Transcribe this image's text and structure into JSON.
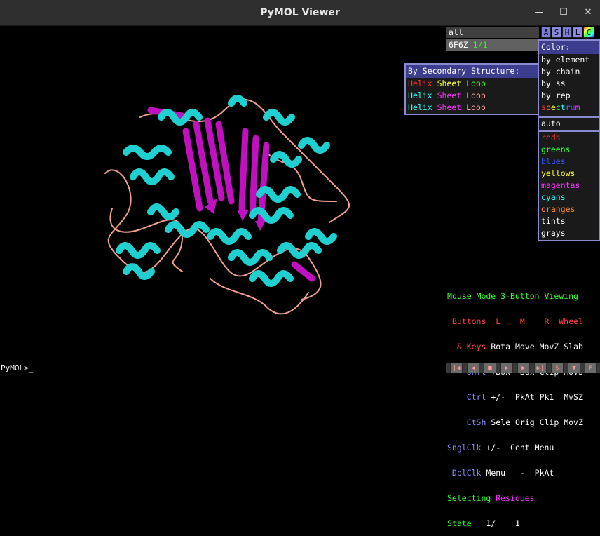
{
  "window": {
    "title": "PyMOL Viewer"
  },
  "command": {
    "prompt": "PyMOL>_"
  },
  "objects": {
    "all": {
      "name": "all"
    },
    "obj1": {
      "name": "6F6Z",
      "frames": "1/1"
    },
    "buttons": [
      {
        "label": "A",
        "color": "#7b7bd8"
      },
      {
        "label": "S",
        "color": "#8a8ae0"
      },
      {
        "label": "H",
        "color": "#7b7bd8"
      },
      {
        "label": "L",
        "color": "#8a8ae0"
      },
      {
        "label": "C",
        "color": "#e8e84a"
      }
    ]
  },
  "ss_menu": {
    "title": "By Secondary Structure:",
    "rows": [
      [
        "Helix",
        "Sheet",
        "Loop"
      ],
      [
        "Helix",
        "Sheet",
        "Loop"
      ],
      [
        "Helix",
        "Sheet",
        "Loop"
      ]
    ],
    "row_colors": [
      [
        "#ff3030",
        "#ffff30",
        "#30ff30"
      ],
      [
        "#30ffff",
        "#ff30ff",
        "#ff9f9f"
      ],
      [
        "#30ffff",
        "#ff30ff",
        "#ff9f9f"
      ]
    ]
  },
  "color_menu": {
    "title": "Color:",
    "items": [
      "by element",
      "by chain",
      "by ss",
      "by rep",
      "spectrum"
    ],
    "auto": "auto",
    "groups": [
      "reds",
      "greens",
      "blues",
      "yellows",
      "magentas",
      "cyans",
      "oranges",
      "tints",
      "grays"
    ],
    "group_colors": [
      "#ff3030",
      "#30ff30",
      "#3050ff",
      "#ffff30",
      "#ff30ff",
      "#30ffff",
      "#ff8c30",
      "#ffffff",
      "#ffffff"
    ]
  },
  "mouse_mode": {
    "title": "Mouse Mode 3-Button Viewing",
    "header": " Buttons  L    M    R  Wheel",
    "rows": [
      [
        "  & Keys",
        " Rota",
        " Move",
        " MovZ",
        " Slab"
      ],
      [
        "    Shft",
        " +Box",
        " -Box",
        " Clip",
        " MovS"
      ],
      [
        "    Ctrl",
        " +/-",
        "  PkAt",
        " Pk1",
        "  MvSZ"
      ],
      [
        "    CtSh",
        " Sele",
        " Orig",
        " Clip",
        " MovZ"
      ],
      [
        "SnglClk",
        " +/-",
        "  Cent",
        " Menu",
        ""
      ],
      [
        " DblClk",
        " Menu",
        "   -",
        "  PkAt",
        ""
      ]
    ],
    "selecting_label": "Selecting",
    "selecting_value": "Residues",
    "state_label": "State",
    "state_value": "   1/    1"
  },
  "vcr": [
    "|◀",
    "◀",
    "■",
    "▶",
    "▶",
    "▶|",
    "S",
    "▼",
    "F"
  ]
}
